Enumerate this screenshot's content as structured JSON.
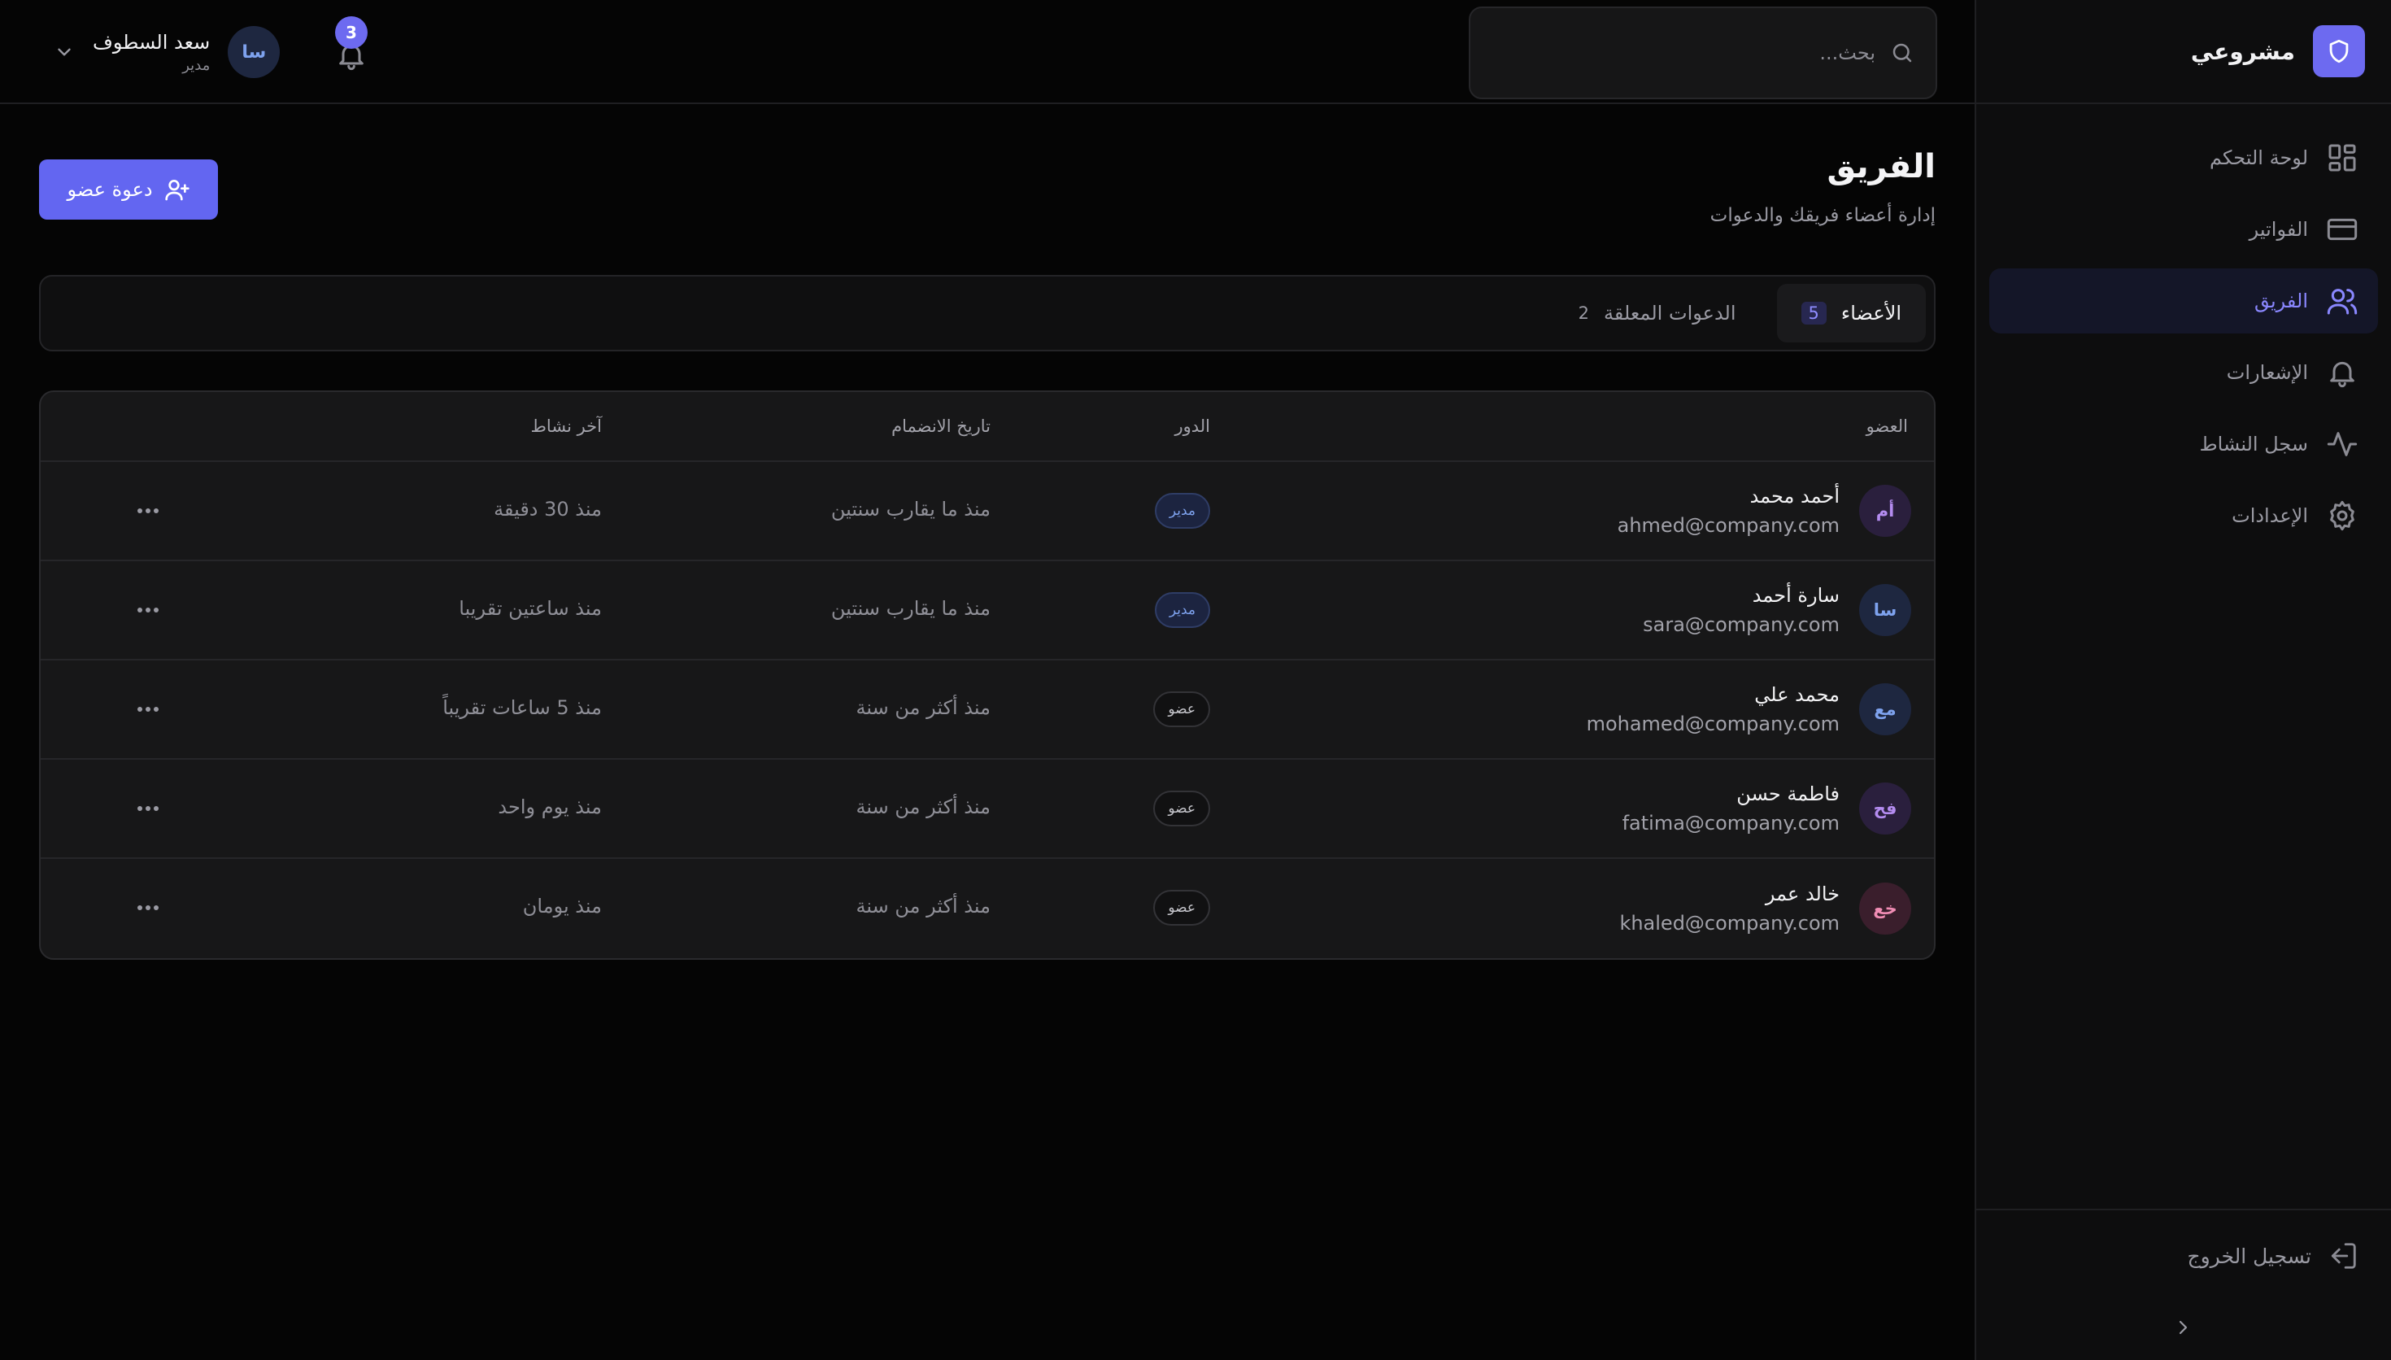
{
  "sidebar": {
    "brand_name": "مشروعي",
    "items": [
      {
        "label": "لوحة التحكم",
        "icon": "dashboard-icon"
      },
      {
        "label": "الفواتير",
        "icon": "credit-card-icon"
      },
      {
        "label": "الفريق",
        "icon": "users-icon",
        "active": true
      },
      {
        "label": "الإشعارات",
        "icon": "bell-icon"
      },
      {
        "label": "سجل النشاط",
        "icon": "activity-icon"
      },
      {
        "label": "الإعدادات",
        "icon": "gear-icon"
      }
    ],
    "logout_label": "تسجيل الخروج"
  },
  "header": {
    "search_placeholder": "بحث...",
    "notification_count": "3",
    "user": {
      "name": "سعد السطوف",
      "role": "مدير",
      "initials": "سا"
    }
  },
  "page": {
    "title": "الفريق",
    "subtitle": "إدارة أعضاء فريقك والدعوات",
    "invite_label": "دعوة عضو"
  },
  "tabs": [
    {
      "label": "الأعضاء",
      "count": "5",
      "active": true
    },
    {
      "label": "الدعوات المعلقة",
      "count": "2",
      "active": false
    }
  ],
  "table": {
    "headers": {
      "member": "العضو",
      "role": "الدور",
      "joined": "تاريخ الانضمام",
      "last_active": "آخر نشاط"
    },
    "rows": [
      {
        "initials": "أم",
        "name": "أحمد محمد",
        "email": "ahmed@company.com",
        "role": "مدير",
        "role_type": "admin",
        "joined": "منذ ما يقارب سنتين",
        "last_active": "منذ 30 دقيقة"
      },
      {
        "initials": "سا",
        "name": "سارة أحمد",
        "email": "sara@company.com",
        "role": "مدير",
        "role_type": "admin",
        "joined": "منذ ما يقارب سنتين",
        "last_active": "منذ ساعتين تقريبا"
      },
      {
        "initials": "مع",
        "name": "محمد علي",
        "email": "mohamed@company.com",
        "role": "عضو",
        "role_type": "member",
        "joined": "منذ أكثر من سنة",
        "last_active": "منذ 5 ساعات تقريباً"
      },
      {
        "initials": "فح",
        "name": "فاطمة حسن",
        "email": "fatima@company.com",
        "role": "عضو",
        "role_type": "member",
        "joined": "منذ أكثر من سنة",
        "last_active": "منذ يوم واحد"
      },
      {
        "initials": "خع",
        "name": "خالد عمر",
        "email": "khaled@company.com",
        "role": "عضو",
        "role_type": "member",
        "joined": "منذ أكثر من سنة",
        "last_active": "منذ يومان"
      }
    ]
  },
  "colors": {
    "accent": "#6366f1",
    "avatar_colors": [
      {
        "bg": "#2a1f3d",
        "fg": "#b48cf0"
      },
      {
        "bg": "#1e2740",
        "fg": "#7ea2ee"
      },
      {
        "bg": "#1e2740",
        "fg": "#7ea2ee"
      },
      {
        "bg": "#2a1f3d",
        "fg": "#b48cf0"
      },
      {
        "bg": "#3a1e2c",
        "fg": "#f08cb4"
      }
    ]
  }
}
